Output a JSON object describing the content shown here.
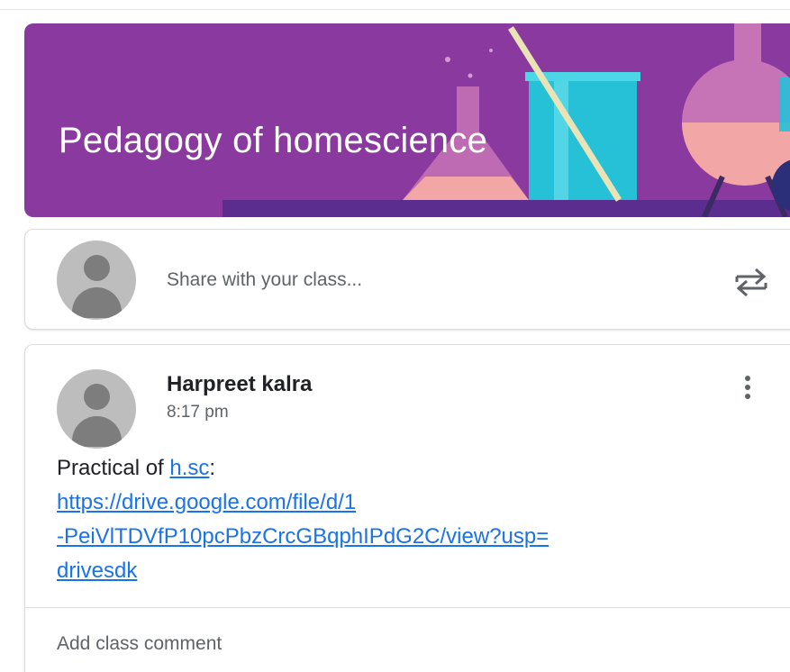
{
  "banner": {
    "class_title": "Pedagogy of homescience",
    "background_color": "#8a3a9f",
    "theme": "science-lab"
  },
  "share": {
    "placeholder": "Share with your class...",
    "repost_icon": "repost-icon"
  },
  "post": {
    "author": "Harpreet kalra",
    "time": "8:17 pm",
    "body_prefix": "Practical of ",
    "inline_link": "h.sc",
    "colon": ":",
    "url_lines": [
      "https://drive.google.com/file/d/1",
      "-PeiVlTDVfP10pcPbzCrcGBqphIPdG2C/view?usp=",
      "drivesdk"
    ],
    "more_icon": "more-vert-icon"
  },
  "comment": {
    "placeholder": "Add class comment"
  },
  "colors": {
    "link": "#1a73e8",
    "avatar_bg": "#bdbdbd",
    "avatar_fg": "#7d7d7d"
  }
}
